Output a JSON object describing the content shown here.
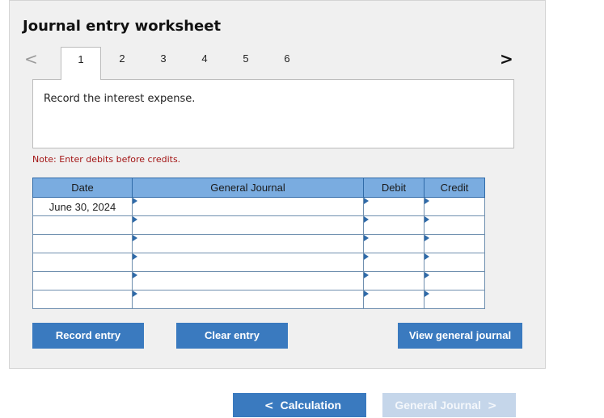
{
  "title": "Journal entry worksheet",
  "tabs": {
    "prev_icon": "<",
    "next_icon": ">",
    "items": [
      "1",
      "2",
      "3",
      "4",
      "5",
      "6"
    ],
    "active": "1"
  },
  "instruction": "Record the interest expense.",
  "note": "Note: Enter debits before credits.",
  "table": {
    "headers": {
      "date": "Date",
      "general_journal": "General Journal",
      "debit": "Debit",
      "credit": "Credit"
    },
    "rows": [
      {
        "date": "June 30, 2024",
        "account": "",
        "debit": "",
        "credit": ""
      },
      {
        "date": "",
        "account": "",
        "debit": "",
        "credit": ""
      },
      {
        "date": "",
        "account": "",
        "debit": "",
        "credit": ""
      },
      {
        "date": "",
        "account": "",
        "debit": "",
        "credit": ""
      },
      {
        "date": "",
        "account": "",
        "debit": "",
        "credit": ""
      },
      {
        "date": "",
        "account": "",
        "debit": "",
        "credit": ""
      }
    ]
  },
  "buttons": {
    "record_entry": "Record entry",
    "clear_entry": "Clear entry",
    "view_general_journal": "View general journal"
  },
  "bottom_nav": {
    "prev_label": "Calculation",
    "prev_icon": "<",
    "next_label": "General Journal",
    "next_icon": ">"
  },
  "colors": {
    "accent": "#3a7abf",
    "header_bg": "#7aace0",
    "note_text": "#a31515",
    "disabled": "#c5d6ea"
  }
}
